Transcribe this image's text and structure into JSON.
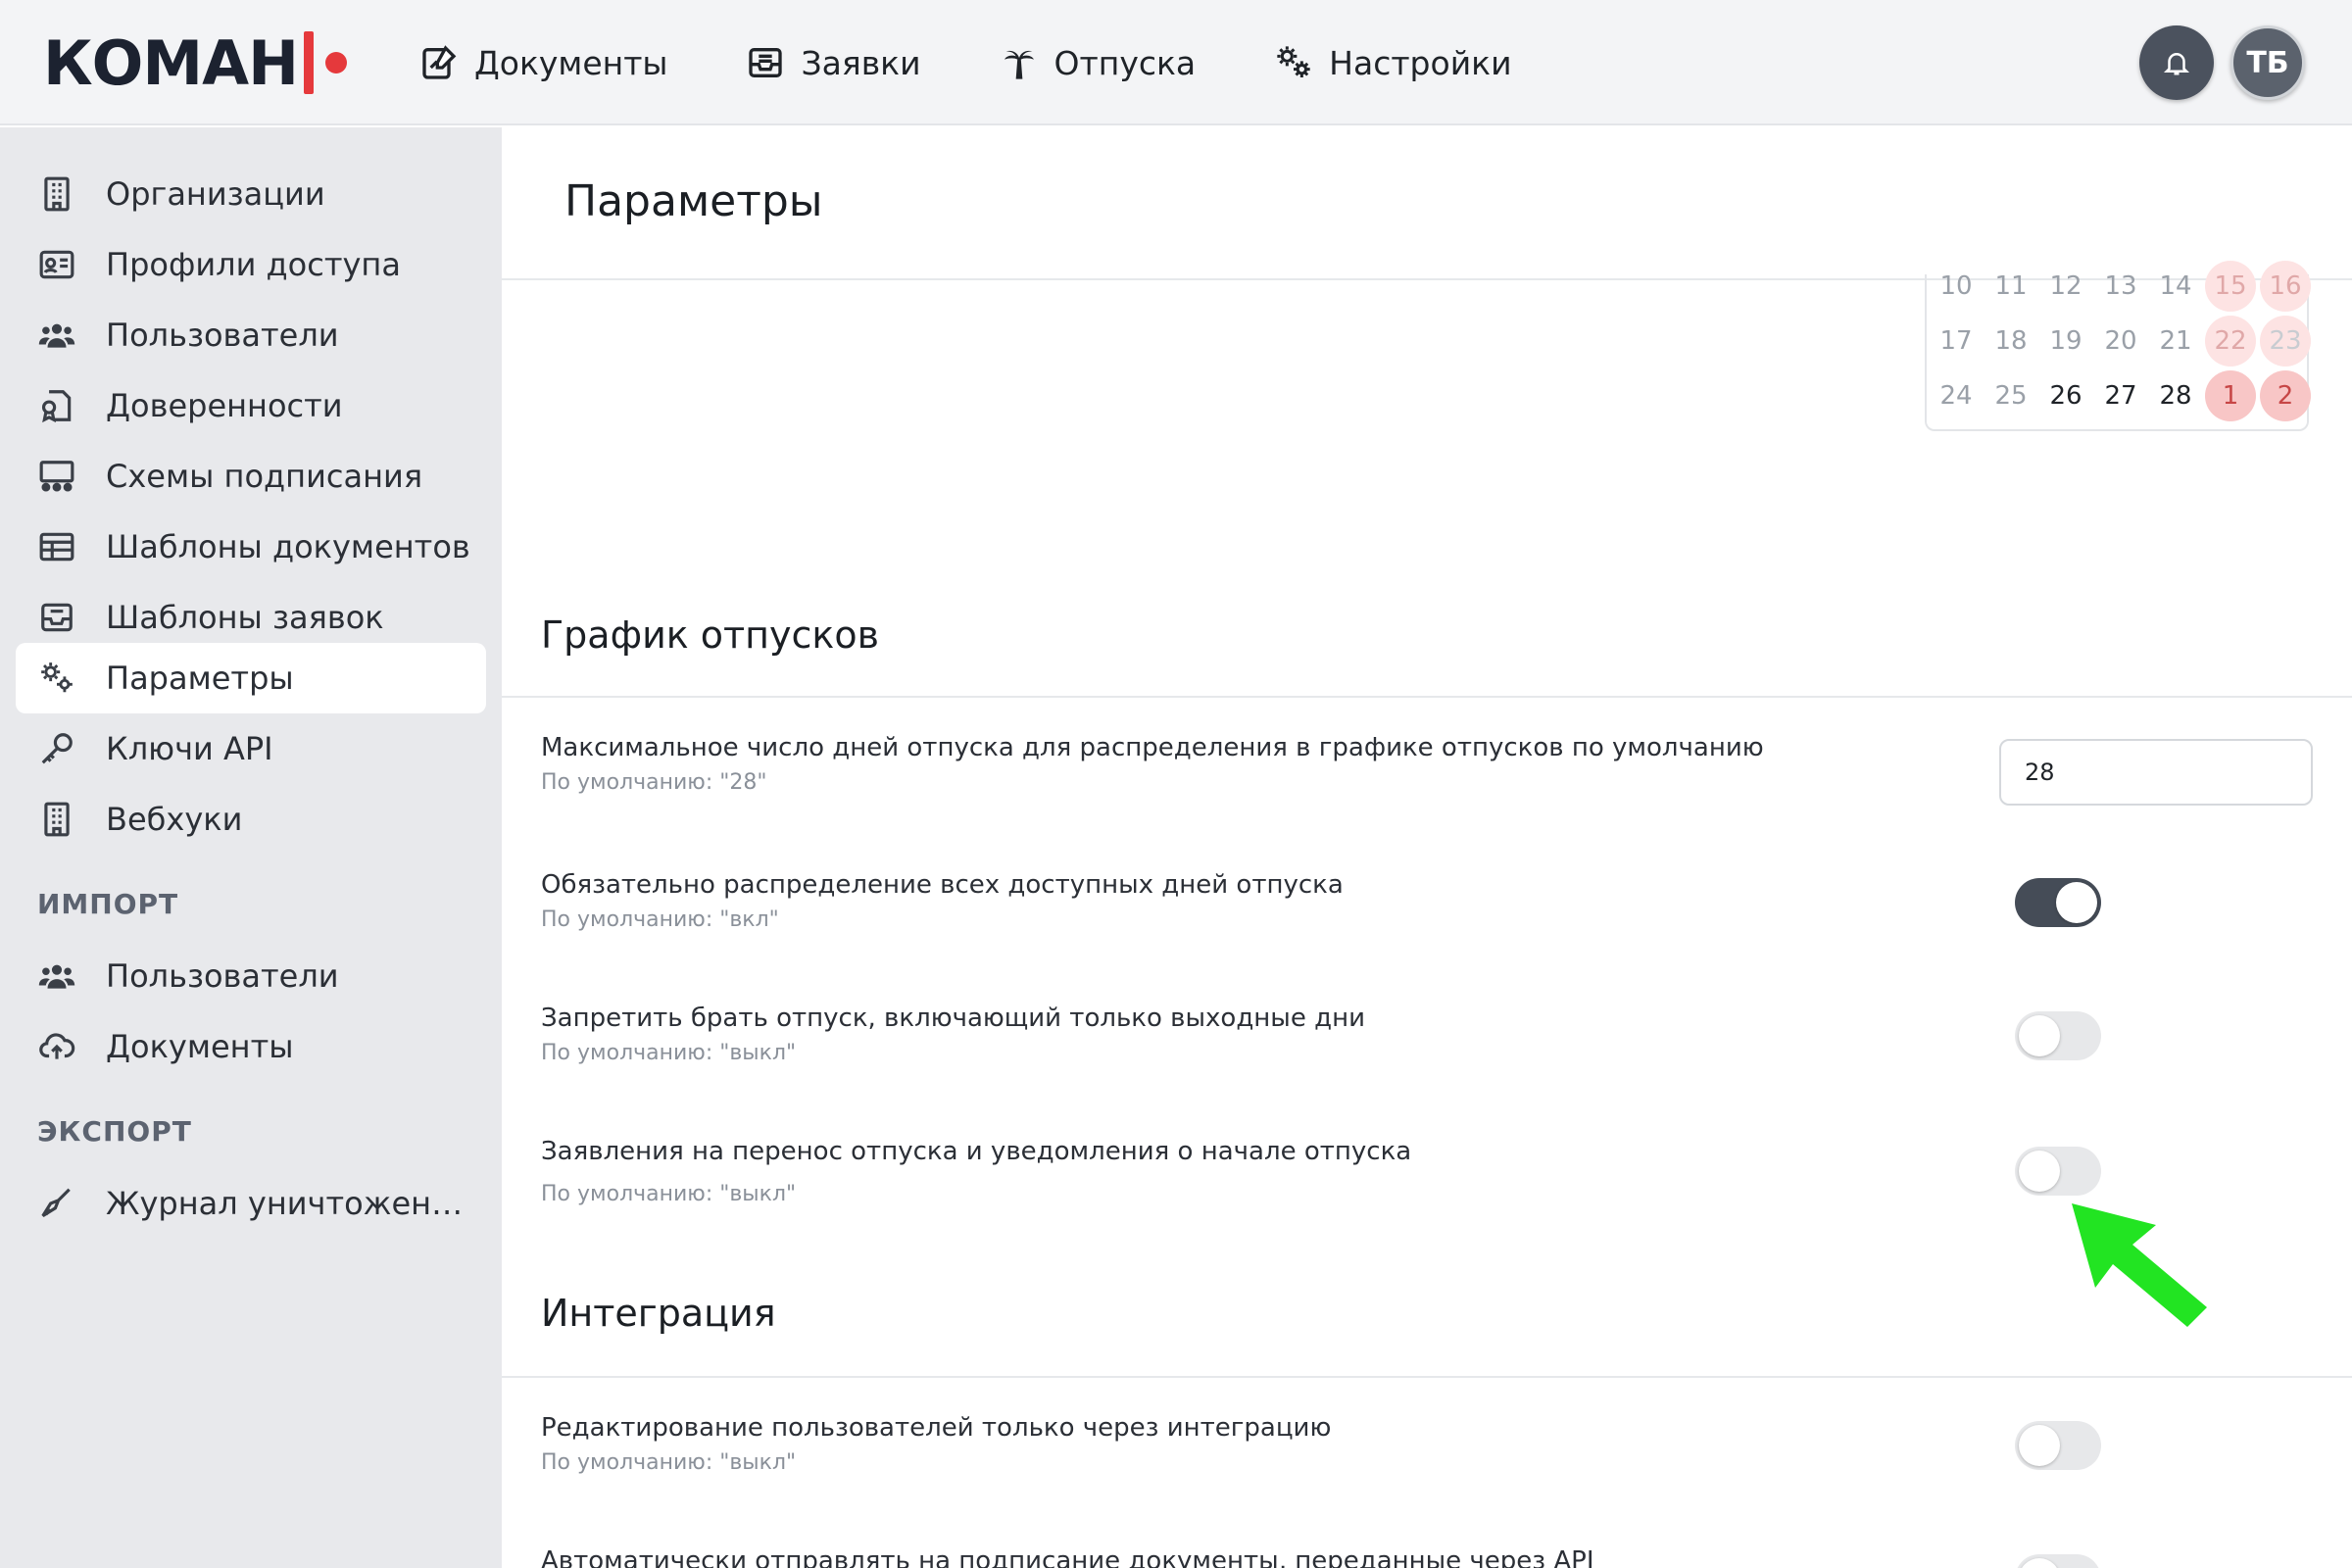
{
  "header": {
    "logo_text": "КОМАН",
    "nav": [
      {
        "label": "Документы",
        "icon": "document-edit-icon"
      },
      {
        "label": "Заявки",
        "icon": "inbox-icon"
      },
      {
        "label": "Отпуска",
        "icon": "palm-tree-icon"
      },
      {
        "label": "Настройки",
        "icon": "gears-icon"
      }
    ],
    "avatar_initials": "ТБ"
  },
  "sidebar": {
    "items": [
      {
        "label": "Организации",
        "icon": "building-icon"
      },
      {
        "label": "Профили доступа",
        "icon": "id-card-icon"
      },
      {
        "label": "Пользователи",
        "icon": "users-icon"
      },
      {
        "label": "Доверенности",
        "icon": "certificate-icon"
      },
      {
        "label": "Схемы подписания",
        "icon": "signing-scheme-icon"
      },
      {
        "label": "Шаблоны документов",
        "icon": "table-icon"
      },
      {
        "label": "Шаблоны заявок",
        "icon": "inbox-icon"
      },
      {
        "label": "Параметры",
        "icon": "gears-icon",
        "active": true
      },
      {
        "label": "Ключи API",
        "icon": "key-icon"
      },
      {
        "label": "Вебхуки",
        "icon": "building-icon"
      }
    ],
    "import_title": "ИМПОРТ",
    "import_items": [
      {
        "label": "Пользователи",
        "icon": "users-icon"
      },
      {
        "label": "Документы",
        "icon": "cloud-upload-icon"
      }
    ],
    "export_title": "ЭКСПОРТ",
    "export_items": [
      {
        "label": "Журнал уничтожения …",
        "icon": "eraser-icon"
      }
    ]
  },
  "main": {
    "page_title": "Параметры",
    "calendar": {
      "rows": [
        [
          "10",
          "11",
          "12",
          "13",
          "14",
          "15",
          "16"
        ],
        [
          "17",
          "18",
          "19",
          "20",
          "21",
          "22",
          "23"
        ],
        [
          "24",
          "25",
          "26",
          "27",
          "28",
          "1",
          "2"
        ]
      ]
    },
    "vacation_section": {
      "title": "График отпусков",
      "max_days_label": "Максимальное число дней отпуска для распределения в графике отпусков по умолчанию",
      "max_days_default": "По умолчанию: \"28\"",
      "max_days_value": "28",
      "distribute_all_label": "Обязательно распределение всех доступных дней отпуска",
      "distribute_all_default": "По умолчанию: \"вкл\"",
      "distribute_all_on": true,
      "forbid_weekend_label": "Запретить брать отпуск, включающий только выходные дни",
      "forbid_weekend_default": "По умолчанию: \"выкл\"",
      "forbid_weekend_on": false,
      "transfer_label": "Заявления на перенос отпуска и уведомления о начале отпуска",
      "transfer_default": "По умолчанию: \"выкл\"",
      "transfer_on": false
    },
    "integration_section": {
      "title": "Интеграция",
      "edit_users_label": "Редактирование пользователей только через интеграцию",
      "edit_users_default": "По умолчанию: \"выкл\"",
      "edit_users_on": false,
      "auto_send_label": "Автоматически отправлять на подписание документы, переданные через API"
    }
  },
  "colors": {
    "accent": "#e5393c",
    "pointer_arrow": "#22e422",
    "toggle_on": "#454c57"
  }
}
